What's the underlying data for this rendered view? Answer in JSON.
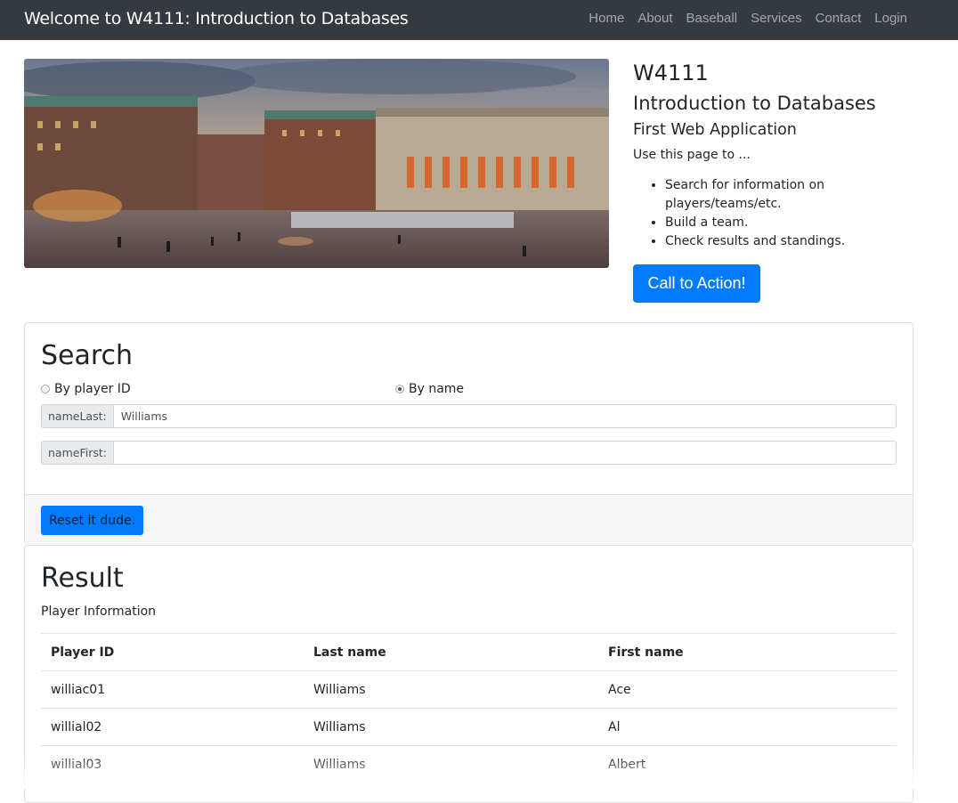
{
  "navbar": {
    "brand": "Welcome to W4111: Introduction to Databases",
    "links": [
      "Home",
      "About",
      "Baseball",
      "Services",
      "Contact",
      "Login"
    ]
  },
  "intro": {
    "title": "W4111",
    "subtitle": "Introduction to Databases",
    "heading": "First Web Application",
    "lead": "Use this page to ...",
    "bullets": [
      "Search for information on players/teams/etc.",
      "Build a team.",
      "Check results and standings."
    ],
    "cta_label": "Call to Action!"
  },
  "search": {
    "title": "Search",
    "radio_options": [
      {
        "label": "By player ID",
        "checked": false
      },
      {
        "label": "By name",
        "checked": true
      }
    ],
    "fields": [
      {
        "label": "nameLast:",
        "value": "Williams"
      },
      {
        "label": "nameFirst:",
        "value": ""
      }
    ],
    "reset_label": "Reset it dude."
  },
  "result": {
    "title": "Result",
    "subtitle": "Player Information",
    "columns": [
      "Player ID",
      "Last name",
      "First name"
    ],
    "rows": [
      [
        "williac01",
        "Williams",
        "Ace"
      ],
      [
        "willial02",
        "Williams",
        "Al"
      ],
      [
        "willial03",
        "Williams",
        "Albert"
      ]
    ]
  },
  "colors": {
    "navbar_bg": "#343a40",
    "primary": "#007bff"
  }
}
